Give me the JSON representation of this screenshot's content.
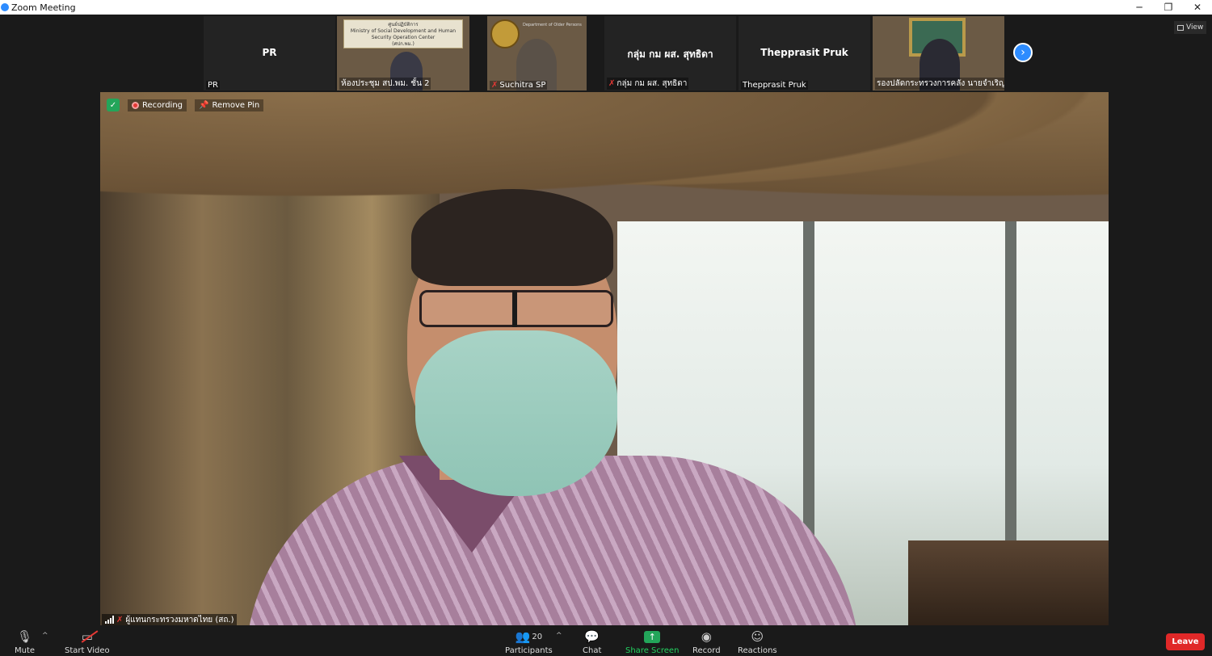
{
  "window": {
    "title": "Zoom Meeting",
    "controls": {
      "minimize": "─",
      "restore": "❐",
      "close": "✕"
    }
  },
  "gallery": {
    "view_label": "View",
    "tiles": [
      {
        "name": "PR",
        "label": "PR",
        "video": false,
        "muted": false
      },
      {
        "name": "",
        "label": "ห้องประชุม สป.พม. ชั้น 2",
        "video": true,
        "muted": false,
        "sign_text_th": "ศูนย์ปฏิบัติการ",
        "sign_text_en": "Ministry of Social Development and Human Security Operation Center",
        "sign_abbr": "(ศปก.พม.)"
      },
      {
        "name": "",
        "label": "Suchitra SP",
        "video": true,
        "muted": true,
        "sign_text": "Department of Older Persons"
      },
      {
        "name": "กลุ่ม กม ผส. สุทธิดา",
        "label": "กลุ่ม กม ผส. สุทธิดา",
        "video": false,
        "muted": true
      },
      {
        "name": "Thepprasit Pruk",
        "label": "Thepprasit Pruk",
        "video": false,
        "muted": false
      },
      {
        "name": "",
        "label": "รองปลัดกระทรวงการคลัง นายจำเริญ โ...",
        "video": true,
        "muted": false
      }
    ],
    "next_icon": "›"
  },
  "main_video": {
    "recording_label": "Recording",
    "remove_pin_label": "Remove Pin",
    "participant_label": "ผู้แทนกระทรวงมหาดไทย (สถ.)",
    "muted": true
  },
  "toolbar": {
    "mute_label": "Mute",
    "start_video_label": "Start Video",
    "participants_label": "Participants",
    "participants_count": "20",
    "chat_label": "Chat",
    "share_screen_label": "Share Screen",
    "record_label": "Record",
    "reactions_label": "Reactions",
    "leave_label": "Leave"
  },
  "colors": {
    "accent_blue": "#2d8cff",
    "share_green": "#23a55a",
    "leave_red": "#e02828",
    "muted_red": "#e53935",
    "background": "#1a1a1a"
  }
}
